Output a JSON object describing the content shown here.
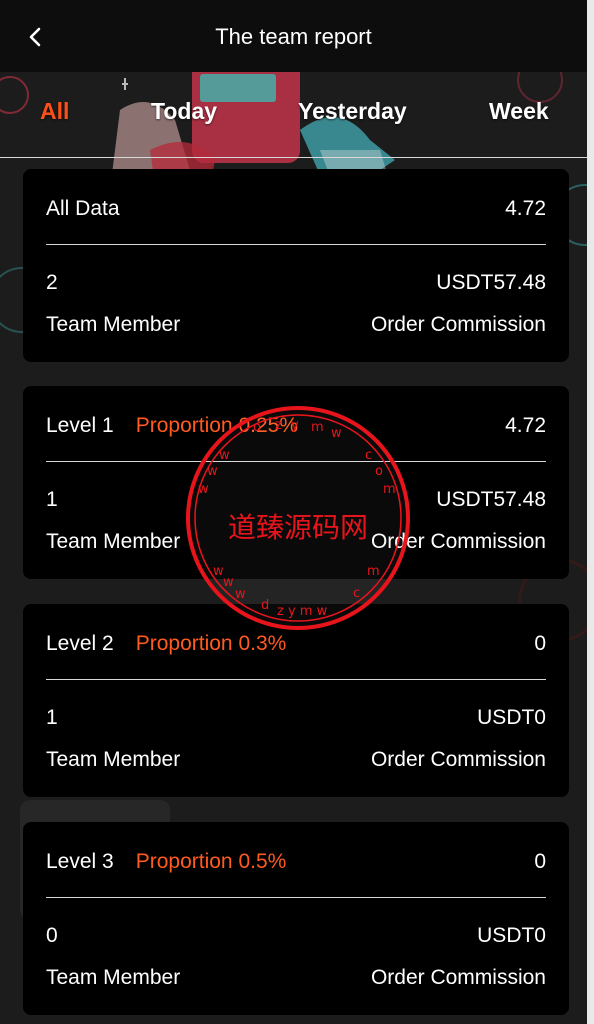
{
  "header": {
    "title": "The team report"
  },
  "tabs": [
    {
      "label": "All",
      "active": true
    },
    {
      "label": "Today",
      "active": false
    },
    {
      "label": "Yesterday",
      "active": false
    },
    {
      "label": "Week",
      "active": false
    }
  ],
  "cards": [
    {
      "title": "All Data",
      "proportion": "",
      "value": "4.72",
      "members": "2",
      "commission": "USDT57.48",
      "members_label": "Team Member",
      "commission_label": "Order Commission"
    },
    {
      "title": "Level 1",
      "proportion": "Proportion 0.25%",
      "value": "4.72",
      "members": "1",
      "commission": "USDT57.48",
      "members_label": "Team Member",
      "commission_label": "Order Commission"
    },
    {
      "title": "Level 2",
      "proportion": "Proportion 0.3%",
      "value": "0",
      "members": "1",
      "commission": "USDT0",
      "members_label": "Team Member",
      "commission_label": "Order Commission"
    },
    {
      "title": "Level 3",
      "proportion": "Proportion 0.5%",
      "value": "0",
      "members": "0",
      "commission": "USDT0",
      "members_label": "Team Member",
      "commission_label": "Order Commission"
    }
  ],
  "watermark": {
    "text": "道臻源码网",
    "ring": "www.dzymw.com"
  },
  "colors": {
    "accent": "#ff4f18",
    "stamp": "#e8141c",
    "card_bg": "#000000",
    "page_bg": "#1c1c1c"
  },
  "icons": {
    "back": "chevron-left-icon"
  }
}
